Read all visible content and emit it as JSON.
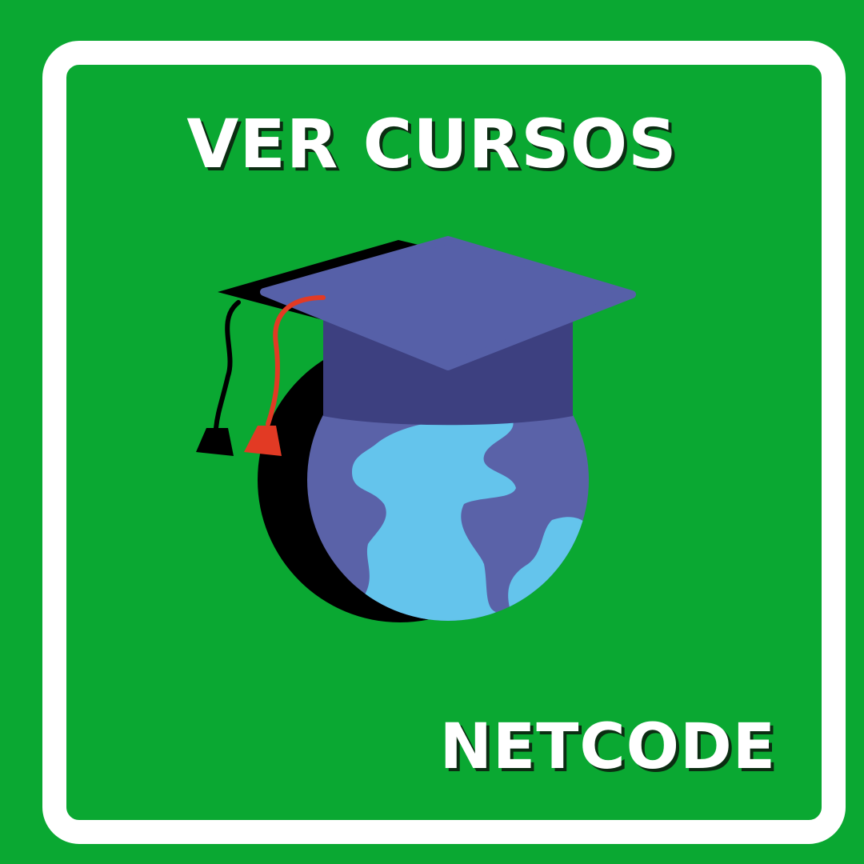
{
  "card": {
    "title": "VER CURSOS",
    "brand": "NETCODE",
    "icon": "graduation-cap-globe-icon"
  },
  "colors": {
    "background": "#0aa832",
    "frame": "#ffffff",
    "text": "#ffffff",
    "cap_top": "#5660a8",
    "cap_band": "#3d4080",
    "globe_ocean": "#5a62a8",
    "globe_land": "#64c4ec",
    "tassel": "#e23a24",
    "shadow": "#000000"
  }
}
